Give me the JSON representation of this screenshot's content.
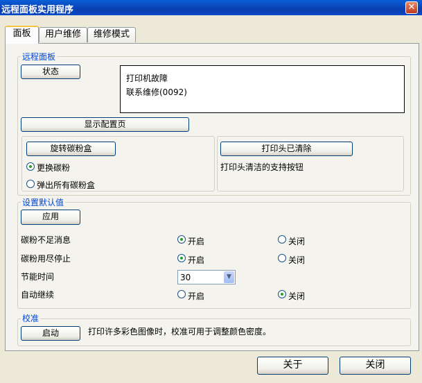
{
  "window": {
    "title": "远程面板实用程序",
    "close_glyph": "✕"
  },
  "tabs": [
    {
      "label": "面板"
    },
    {
      "label": "用户维修"
    },
    {
      "label": "维修模式"
    }
  ],
  "remote_panel": {
    "legend": "远程面板",
    "status_button": "状态",
    "status_lines": [
      "打印机故障",
      "联系维修(0092)"
    ],
    "config_button": "显示配置页",
    "toner": {
      "rotate_button": "旋转碳粉盒",
      "options": [
        {
          "label": "更换碳粉",
          "selected": true
        },
        {
          "label": "弹出所有碳粉盒",
          "selected": false
        }
      ]
    },
    "printhead": {
      "button": "打印头已清除",
      "description": "打印头清洁的支持按钮"
    }
  },
  "defaults": {
    "legend": "设置默认值",
    "apply_button": "应用",
    "rows": [
      {
        "label": "碳粉不足消息",
        "on_label": "开启",
        "off_label": "关闭",
        "value": "on"
      },
      {
        "label": "碳粉用尽停止",
        "on_label": "开启",
        "off_label": "关闭",
        "value": "on"
      },
      {
        "label": "节能时间",
        "select_value": "30",
        "arrow": "▼"
      },
      {
        "label": "自动继续",
        "on_label": "开启",
        "off_label": "关闭",
        "value": "off"
      }
    ]
  },
  "calibration": {
    "legend": "校准",
    "start_button": "启动",
    "description": "打印许多彩色图像时，校准可用于调整颜色密度。"
  },
  "footer": {
    "about_button": "关于",
    "close_button": "关闭"
  }
}
